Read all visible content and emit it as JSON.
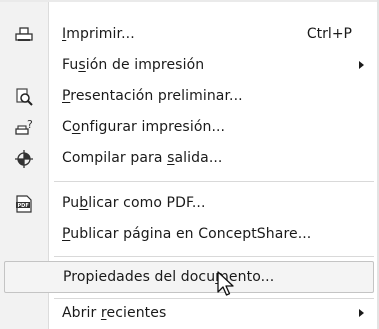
{
  "menu": {
    "items": [
      {
        "pre": "",
        "u": "I",
        "post": "mprimir...",
        "shortcut": "Ctrl+P",
        "submenu": false,
        "icon": "printer-icon"
      },
      {
        "pre": "Fu",
        "u": "s",
        "post": "ión de impresión",
        "shortcut": "",
        "submenu": true,
        "icon": ""
      },
      {
        "pre": "",
        "u": "P",
        "post": "resentación preliminar...",
        "shortcut": "",
        "submenu": false,
        "icon": "print-preview-icon"
      },
      {
        "pre": "C",
        "u": "o",
        "post": "nfigurar impresión...",
        "shortcut": "",
        "submenu": false,
        "icon": "print-setup-icon"
      },
      {
        "pre": "Compilar para ",
        "u": "s",
        "post": "alida...",
        "shortcut": "",
        "submenu": false,
        "icon": "prepress-target-icon"
      },
      {
        "pre": "Pu",
        "u": "b",
        "post": "licar como PDF...",
        "shortcut": "",
        "submenu": false,
        "icon": "pdf-icon"
      },
      {
        "pre": "",
        "u": "P",
        "post": "ublicar página en ConceptShare...",
        "shortcut": "",
        "submenu": false,
        "icon": ""
      },
      {
        "pre": "Propiedades del docu",
        "u": "m",
        "post": "ento...",
        "shortcut": "",
        "submenu": false,
        "icon": "",
        "highlighted": true
      },
      {
        "pre": "Abrir ",
        "u": "r",
        "post": "ecientes",
        "shortcut": "",
        "submenu": true,
        "icon": ""
      }
    ]
  }
}
